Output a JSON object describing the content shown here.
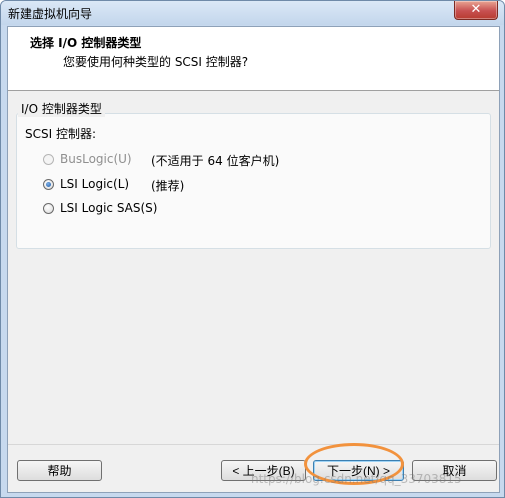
{
  "window": {
    "title": "新建虚拟机向导",
    "close_glyph": "✕"
  },
  "header": {
    "title": "选择 I/O 控制器类型",
    "subtitle": "您要使用何种类型的 SCSI 控制器?"
  },
  "group": {
    "legend": "I/O 控制器类型",
    "field_label": "SCSI 控制器:",
    "options": [
      {
        "label": "BusLogic(U)",
        "note": "(不适用于 64 位客户机)",
        "selected": false,
        "enabled": false
      },
      {
        "label": "LSI Logic(L)",
        "note": "(推荐)",
        "selected": true,
        "enabled": true
      },
      {
        "label": "LSI Logic SAS(S)",
        "note": "",
        "selected": false,
        "enabled": true
      }
    ]
  },
  "buttons": {
    "help": "帮助",
    "back": "< 上一步(B)",
    "next": "下一步(N) >",
    "cancel": "取消"
  },
  "annotation": {
    "color": "#f2923d"
  },
  "watermark": "https://blog.csdn.net/qq_33703815",
  "colors": {
    "accent": "#3c7fb1",
    "titlebar": "#c7d9ee",
    "close": "#c75050"
  }
}
